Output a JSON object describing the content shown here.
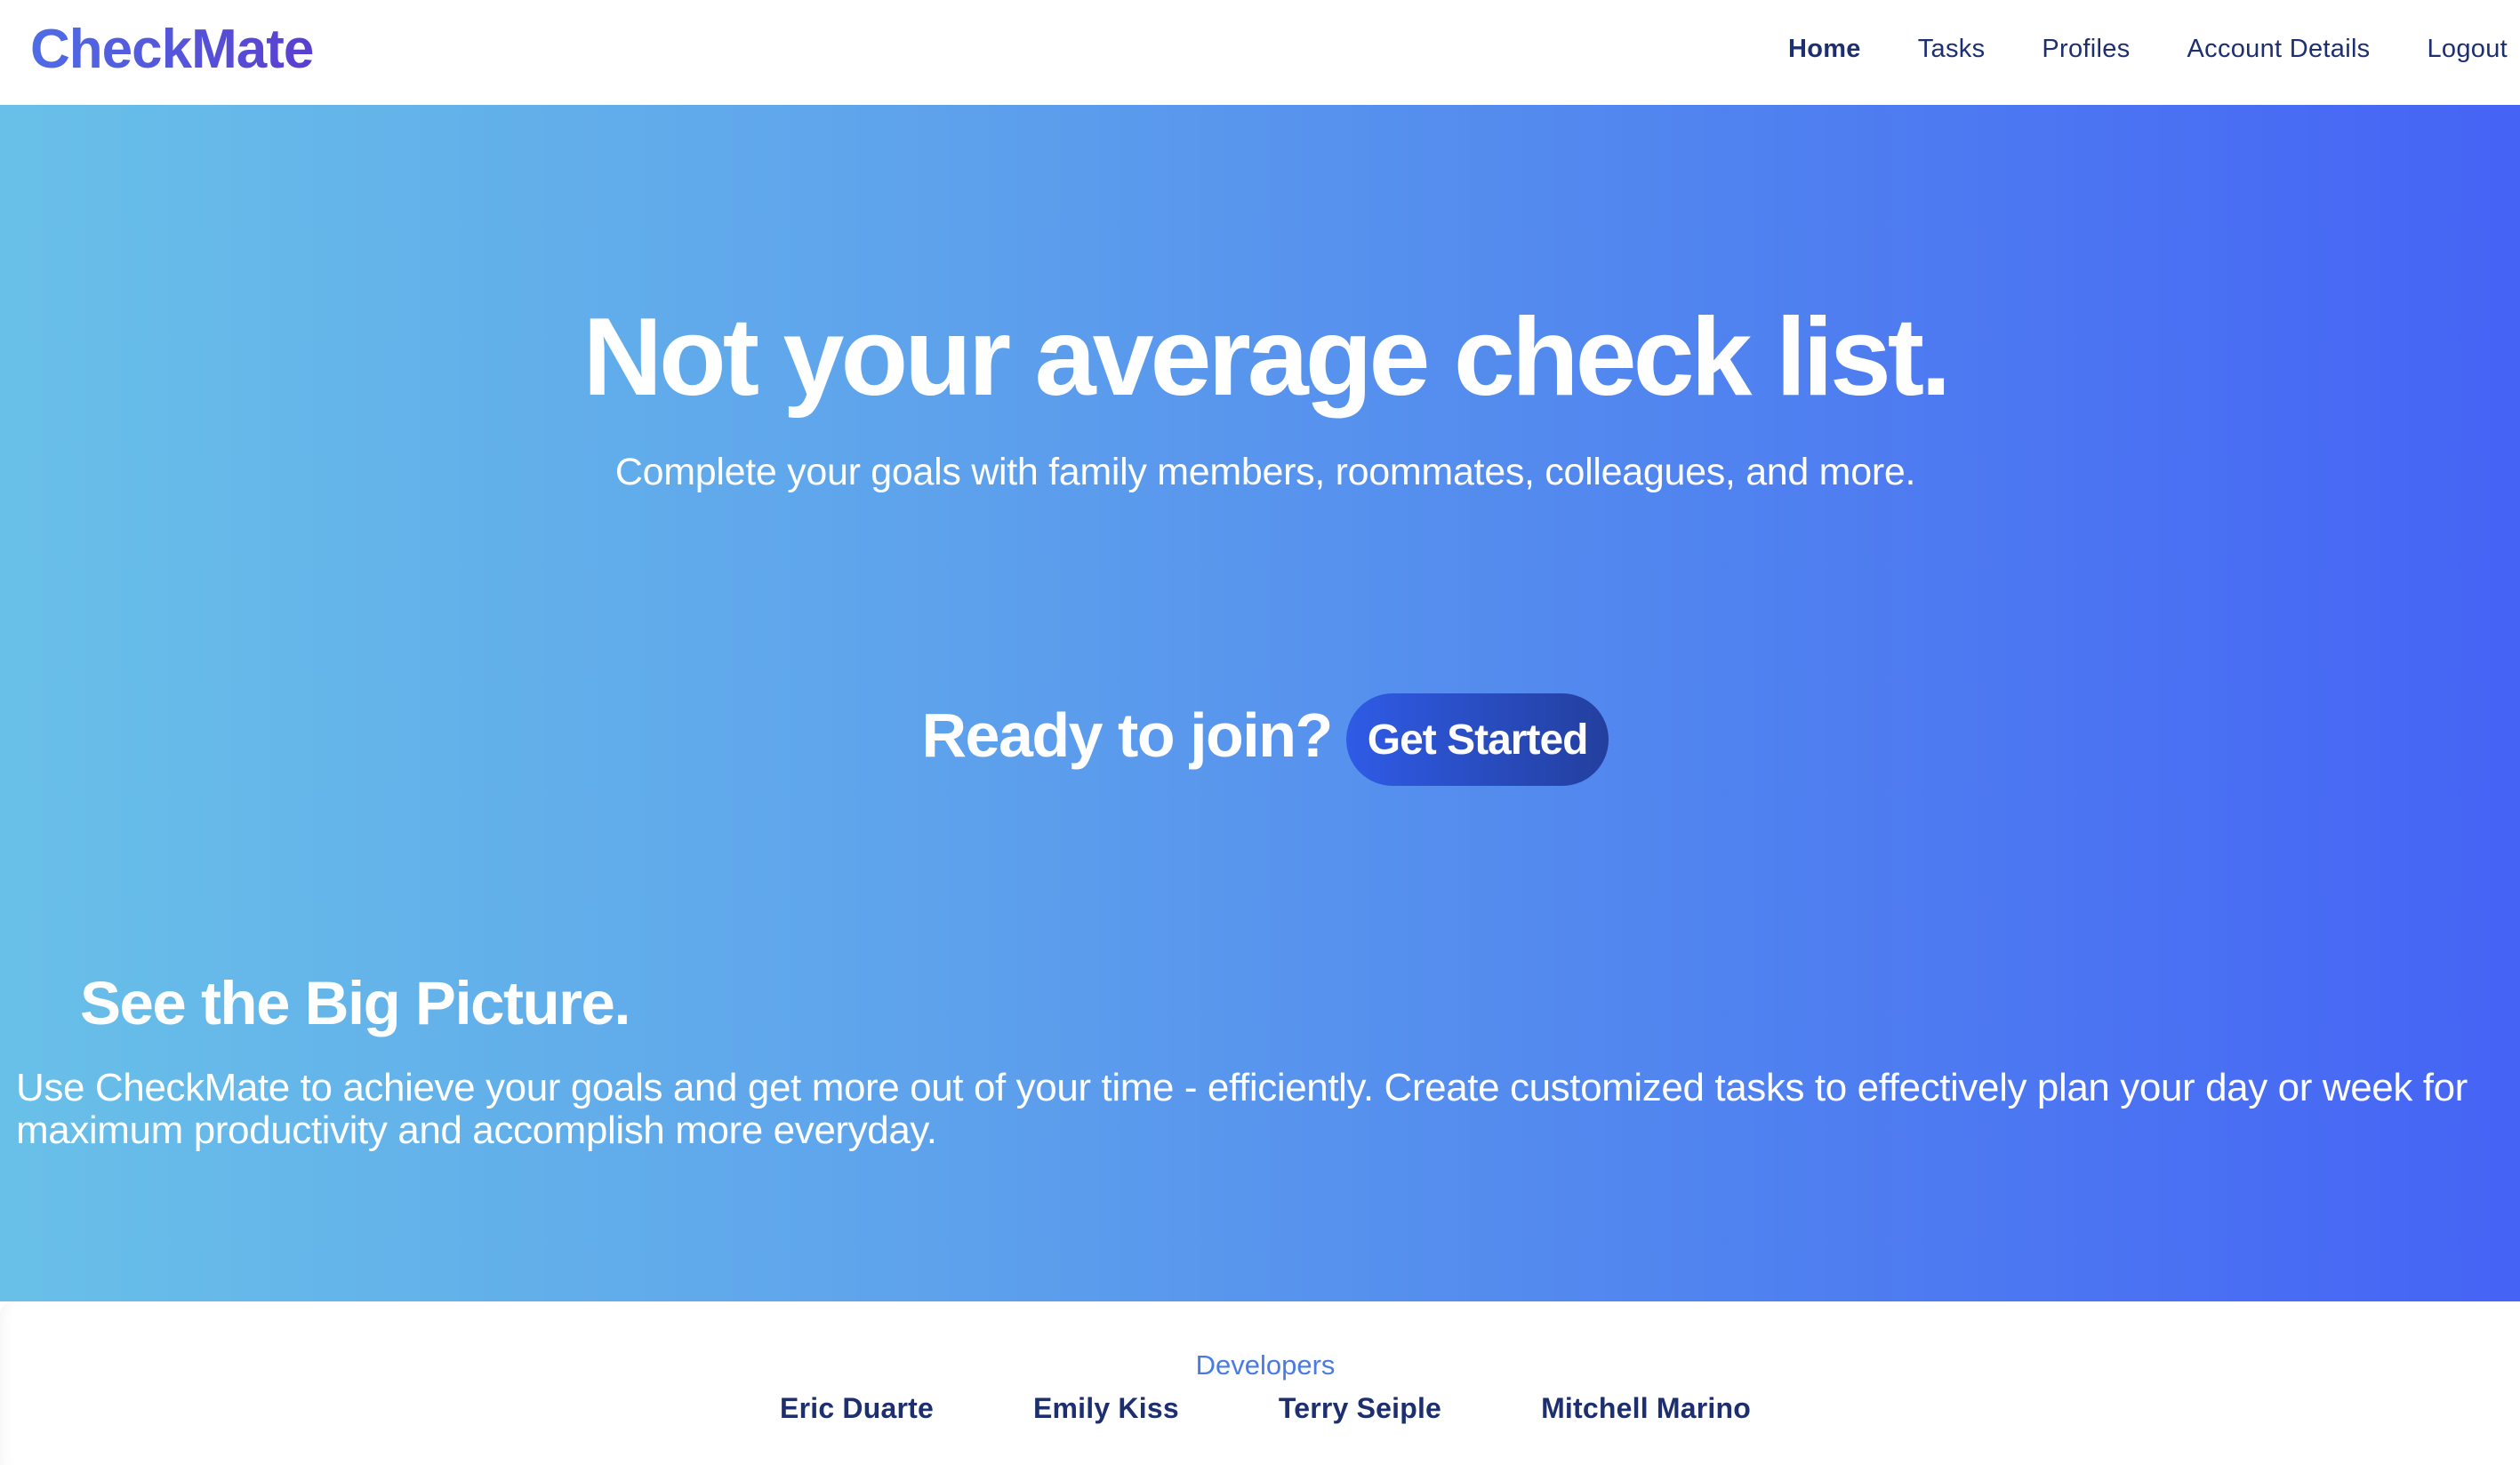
{
  "header": {
    "brand": "CheckMate",
    "nav": [
      {
        "label": "Home",
        "active": true
      },
      {
        "label": "Tasks"
      },
      {
        "label": "Profiles"
      },
      {
        "label": "Account Details"
      },
      {
        "label": "Logout"
      }
    ]
  },
  "hero": {
    "title": "Not your average check list.",
    "subtitle": "Complete your goals with family members, roommates, colleagues, and more.",
    "join_text": "Ready to join?",
    "cta_label": "Get Started",
    "section_title": "See the Big Picture.",
    "section_text": "Use CheckMate to achieve your goals and get more out of your time - efficiently. Create customized tasks to effectively plan your day or week for maximum productivity and accomplish more everyday."
  },
  "footer": {
    "heading": "Developers",
    "developers": [
      "Eric Duarte",
      "Emily Kiss",
      "Terry Seiple",
      "Mitchell Marino"
    ]
  },
  "colors": {
    "brand_gradient_start": "#4f6ce6",
    "brand_gradient_end": "#5a3fd0",
    "hero_gradient_start": "#68c0e8",
    "hero_gradient_end": "#4563f5",
    "nav_text": "#1d2f6f",
    "cta_start": "#2f5be6",
    "cta_end": "#233f9e",
    "footer_heading": "#4a7be3"
  }
}
